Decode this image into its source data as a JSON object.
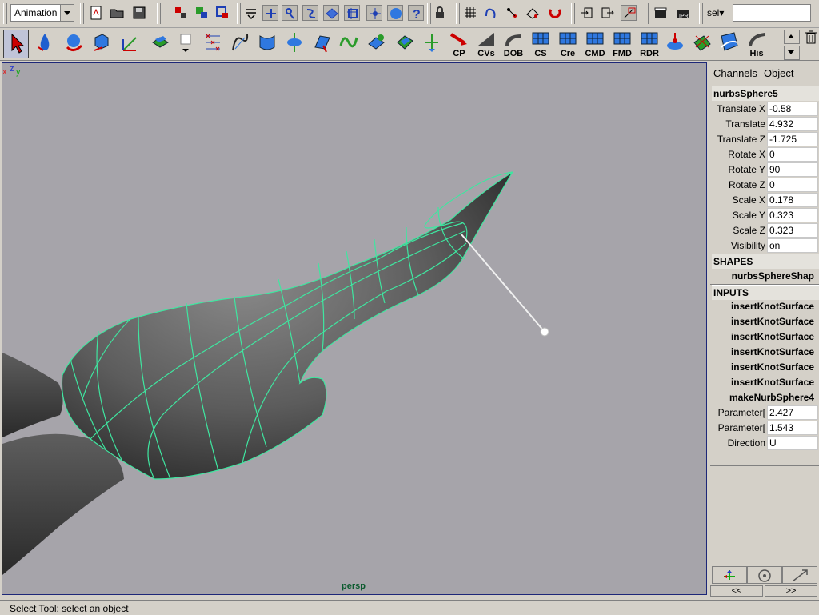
{
  "status_line": {
    "menu_set": "Animation",
    "selection_mask_label": "sel▾",
    "selection_input_value": "",
    "icons": [
      "new-scene",
      "open-scene",
      "save-scene",
      "select-hierarchy",
      "select-object",
      "select-component",
      "mask-handles",
      "mask-joints",
      "mask-curves",
      "mask-surfaces",
      "mask-deformations",
      "mask-dynamics",
      "mask-rendering",
      "mask-misc",
      "lock-selection",
      "snap-grid",
      "snap-curve",
      "snap-point",
      "snap-view-plane",
      "make-live",
      "input-ops",
      "output-ops",
      "construction-history",
      "render-frame",
      "ipr-render"
    ],
    "accent_color": "#1e3fb4"
  },
  "shelf": {
    "tools": [
      {
        "name": "select-tool",
        "label": ""
      },
      {
        "name": "water-tool",
        "label": ""
      },
      {
        "name": "sphere-tool",
        "label": ""
      },
      {
        "name": "cube-tool",
        "label": ""
      },
      {
        "name": "transform-tool",
        "label": ""
      },
      {
        "name": "plane-tool",
        "label": ""
      },
      {
        "name": "last-tool",
        "label": ""
      },
      {
        "name": "knot-tool",
        "label": ""
      },
      {
        "name": "curve-tool",
        "label": ""
      },
      {
        "name": "loft-tool",
        "label": ""
      },
      {
        "name": "revolve-tool",
        "label": ""
      },
      {
        "name": "planar-tool",
        "label": ""
      },
      {
        "name": "wave-tool",
        "label": ""
      },
      {
        "name": "boundary-tool",
        "label": ""
      },
      {
        "name": "square-tool",
        "label": ""
      },
      {
        "name": "normals-tool",
        "label": ""
      },
      {
        "name": "cp-tool",
        "label": "CP"
      },
      {
        "name": "cvs-tool",
        "label": "CVs"
      },
      {
        "name": "dob-tool",
        "label": "DOB"
      },
      {
        "name": "cs-tool",
        "label": "CS"
      },
      {
        "name": "cre-tool",
        "label": "Cre"
      },
      {
        "name": "cmd-tool",
        "label": "CMD"
      },
      {
        "name": "fmd-tool",
        "label": "FMD"
      },
      {
        "name": "rdr-tool",
        "label": "RDR"
      },
      {
        "name": "sculpt-tool",
        "label": ""
      },
      {
        "name": "paint-tool",
        "label": ""
      },
      {
        "name": "hull-tool",
        "label": ""
      },
      {
        "name": "his-tool",
        "label": "His"
      }
    ]
  },
  "viewport": {
    "camera": "persp",
    "background": "#a6a4aa",
    "wireframe_color": "#3fe6a0",
    "axis": {
      "x": "x",
      "y": "y",
      "z": "z"
    }
  },
  "channel_box": {
    "menu": [
      "Channels",
      "Object"
    ],
    "object_name": "nurbsSphere5",
    "channels": [
      {
        "name": "Translate X",
        "value": "-0.58"
      },
      {
        "name": "Translate",
        "value": "4.932"
      },
      {
        "name": "Translate Z",
        "value": "-1.725"
      },
      {
        "name": "Rotate X",
        "value": "0"
      },
      {
        "name": "Rotate Y",
        "value": "90"
      },
      {
        "name": "Rotate Z",
        "value": "0"
      },
      {
        "name": "Scale X",
        "value": "0.178"
      },
      {
        "name": "Scale Y",
        "value": "0.323"
      },
      {
        "name": "Scale Z",
        "value": "0.323"
      },
      {
        "name": "Visibility",
        "value": "on"
      }
    ],
    "shapes_header": "SHAPES",
    "shapes": [
      "nurbsSphereShap"
    ],
    "inputs_header": "INPUTS",
    "inputs": [
      "insertKnotSurface",
      "insertKnotSurface",
      "insertKnotSurface",
      "insertKnotSurface",
      "insertKnotSurface",
      "insertKnotSurface",
      "makeNurbSphere4"
    ],
    "input_attrs": [
      {
        "name": "Parameter[",
        "value": "2.427"
      },
      {
        "name": "Parameter[",
        "value": "1.543"
      },
      {
        "name": "Direction",
        "value": "U"
      }
    ],
    "nav_prev": "<<",
    "nav_next": ">>"
  },
  "help_line": {
    "text": "Select Tool: select an object"
  }
}
